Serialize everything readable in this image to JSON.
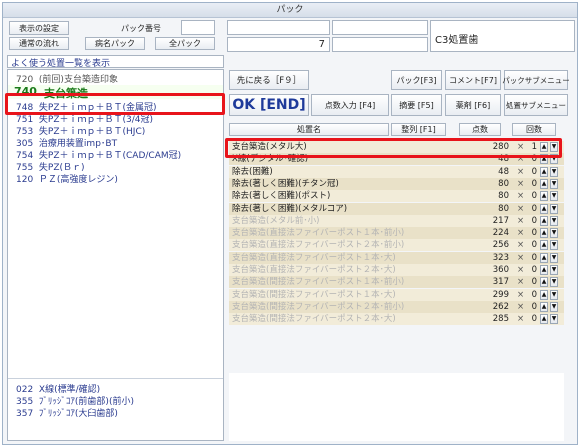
{
  "window": {
    "title": "パック"
  },
  "top_left": {
    "display_settings": "表示の設定",
    "pack_number_label": "パック番号",
    "normal_flow": "通常の流れ",
    "disease_pack": "病名パック",
    "all_pack": "全パック"
  },
  "top_center": {
    "value": "7"
  },
  "top_right": {
    "label": "C3処置歯"
  },
  "toolbar": {
    "back": "先に戻る［F９］",
    "pack": "パック[F3]",
    "comment": "コメント[F7]",
    "pack_sub_menu": "パックサブメニュー",
    "ok": "OK [END]",
    "points_input": "点数入力 [F4]",
    "summary": "摘要 [F5]",
    "drug": "薬剤 [F6]",
    "treatment_sub_menu": "処置サブメニュー"
  },
  "left_pane": {
    "header": "よく使う処置一覧を表示",
    "items": [
      {
        "code": "720",
        "name": "(前回)支台築造印象"
      },
      {
        "code": "740",
        "name": "支台築造"
      },
      {
        "code": "748",
        "name": "失PZ＋ｉｍｐ＋ＢＴ(金属冠)"
      },
      {
        "code": "751",
        "name": "失PZ＋ｉｍｐ＋ＢＴ(3/4冠)"
      },
      {
        "code": "753",
        "name": "失PZ＋ｉｍｐ＋ＢＴ(HJC)"
      },
      {
        "code": "305",
        "name": "治療用装置imp･BT"
      },
      {
        "code": "754",
        "name": "失PZ＋ｉｍｐ＋ＢＴ(CAD/CAM冠)"
      },
      {
        "code": "755",
        "name": "失PZ(Ｂｒ)"
      },
      {
        "code": "120",
        "name": "ＰＺ(高強度レジン)"
      }
    ],
    "bottom_items": [
      {
        "code": "022",
        "name": "X線(標準/確認)"
      },
      {
        "code": "355",
        "name": "ﾌﾞﾘｯｼﾞｺｱ(前歯部)(前小)"
      },
      {
        "code": "357",
        "name": "ﾌﾞﾘｯｼﾞｺｱ(大臼歯部)"
      }
    ]
  },
  "grid": {
    "headers": {
      "name": "処置名",
      "sort": "整列 [F1]",
      "points": "点数",
      "count": "回数"
    },
    "rows": [
      {
        "name": "支台築造(メタル大)",
        "points": "280",
        "count": "1",
        "gray": false
      },
      {
        "name": "X線(デジタル･確認)",
        "points": "48",
        "count": "0",
        "gray": false
      },
      {
        "name": "除去(困難)",
        "points": "48",
        "count": "0",
        "gray": false
      },
      {
        "name": "除去(著しく困難)(チタン冠)",
        "points": "80",
        "count": "0",
        "gray": false
      },
      {
        "name": "除去(著しく困難)(ポスト)",
        "points": "80",
        "count": "0",
        "gray": false
      },
      {
        "name": "除去(著しく困難)(メタルコア)",
        "points": "80",
        "count": "0",
        "gray": false
      },
      {
        "name": "支台築造(メタル前･小)",
        "points": "217",
        "count": "0",
        "gray": true
      },
      {
        "name": "支台築造(直接法ファイバーポスト１本･前小)",
        "points": "224",
        "count": "0",
        "gray": true
      },
      {
        "name": "支台築造(直接法ファイバーポスト２本･前小)",
        "points": "256",
        "count": "0",
        "gray": true
      },
      {
        "name": "支台築造(直接法ファイバーポスト１本･大)",
        "points": "323",
        "count": "0",
        "gray": true
      },
      {
        "name": "支台築造(直接法ファイバーポスト２本･大)",
        "points": "360",
        "count": "0",
        "gray": true
      },
      {
        "name": "支台築造(間接法ファイバーポスト１本･前小)",
        "points": "317",
        "count": "0",
        "gray": true
      },
      {
        "name": "支台築造(間接法ファイバーポスト１本･大)",
        "points": "299",
        "count": "0",
        "gray": true
      },
      {
        "name": "支台築造(間接法ファイバーポスト２本･前小)",
        "points": "262",
        "count": "0",
        "gray": true
      },
      {
        "name": "支台築造(間接法ファイバーポスト２本･大)",
        "points": "285",
        "count": "0",
        "gray": true
      }
    ],
    "times_symbol": "×",
    "up_arrow": "▲",
    "down_arrow": "▼"
  }
}
